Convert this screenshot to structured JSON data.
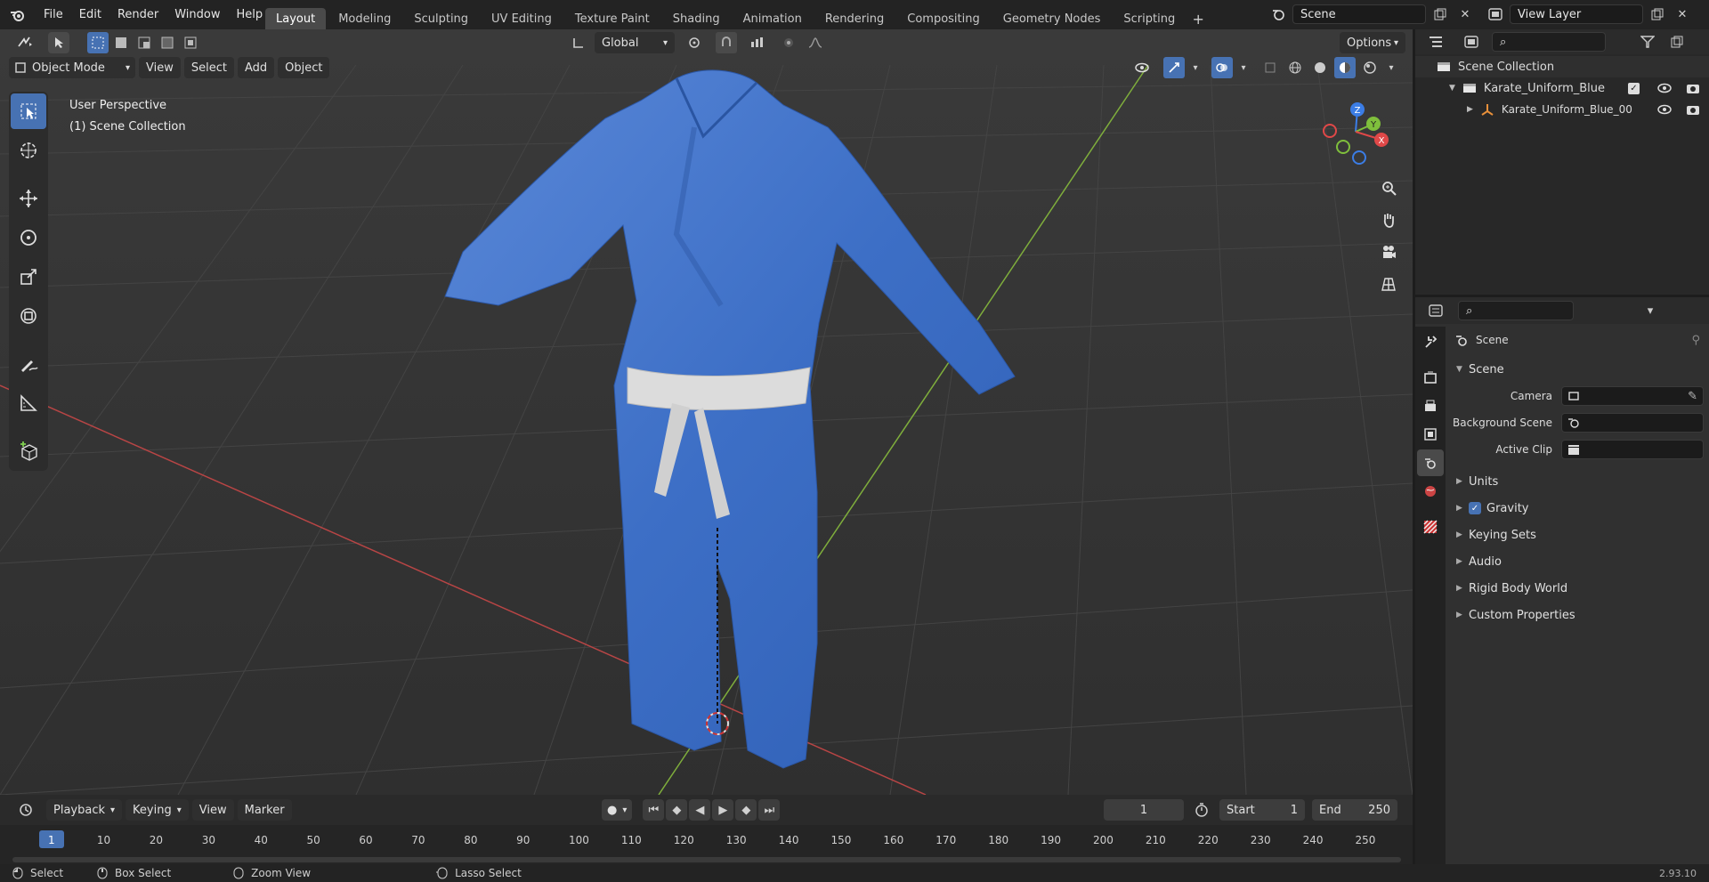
{
  "menu": {
    "items": [
      "File",
      "Edit",
      "Render",
      "Window",
      "Help"
    ]
  },
  "workspaces": [
    "Layout",
    "Modeling",
    "Sculpting",
    "UV Editing",
    "Texture Paint",
    "Shading",
    "Animation",
    "Rendering",
    "Compositing",
    "Geometry Nodes",
    "Scripting"
  ],
  "scene_field": "Scene",
  "viewlayer_field": "View Layer",
  "viewport": {
    "transform_orientation": "Global",
    "options_label": "Options",
    "mode": "Object Mode",
    "header_menus": [
      "View",
      "Select",
      "Add",
      "Object"
    ],
    "overlay_text_1": "User Perspective",
    "overlay_text_2": "(1) Scene Collection",
    "gizmo": {
      "x": "X",
      "y": "Y",
      "z": "Z"
    }
  },
  "outliner": {
    "root": "Scene Collection",
    "collection": "Karate_Uniform_Blue",
    "object": "Karate_Uniform_Blue_00"
  },
  "properties": {
    "breadcrumb": "Scene",
    "panel": "Scene",
    "fields": {
      "camera_label": "Camera",
      "background_label": "Background Scene",
      "clip_label": "Active Clip"
    },
    "sections": [
      "Units",
      "Gravity",
      "Keying Sets",
      "Audio",
      "Rigid Body World",
      "Custom Properties"
    ],
    "gravity_checked": true
  },
  "timeline": {
    "menus": [
      "Playback",
      "Keying",
      "View",
      "Marker"
    ],
    "current_frame": "1",
    "start_label": "Start",
    "start_value": "1",
    "end_label": "End",
    "end_value": "250",
    "ticks": [
      "1",
      "10",
      "20",
      "30",
      "40",
      "50",
      "60",
      "70",
      "80",
      "90",
      "100",
      "110",
      "120",
      "130",
      "140",
      "150",
      "160",
      "170",
      "180",
      "190",
      "200",
      "210",
      "220",
      "230",
      "240",
      "250"
    ]
  },
  "status": {
    "select": "Select",
    "box_select": "Box Select",
    "zoom_view": "Zoom View",
    "lasso_select": "Lasso Select",
    "version": "2.93.10"
  },
  "colors": {
    "accent": "#4772b3",
    "gi_blue": "#3d6fc6",
    "belt": "#d9d9d9",
    "x_axis": "#c04848",
    "y_axis": "#7fae3c"
  }
}
